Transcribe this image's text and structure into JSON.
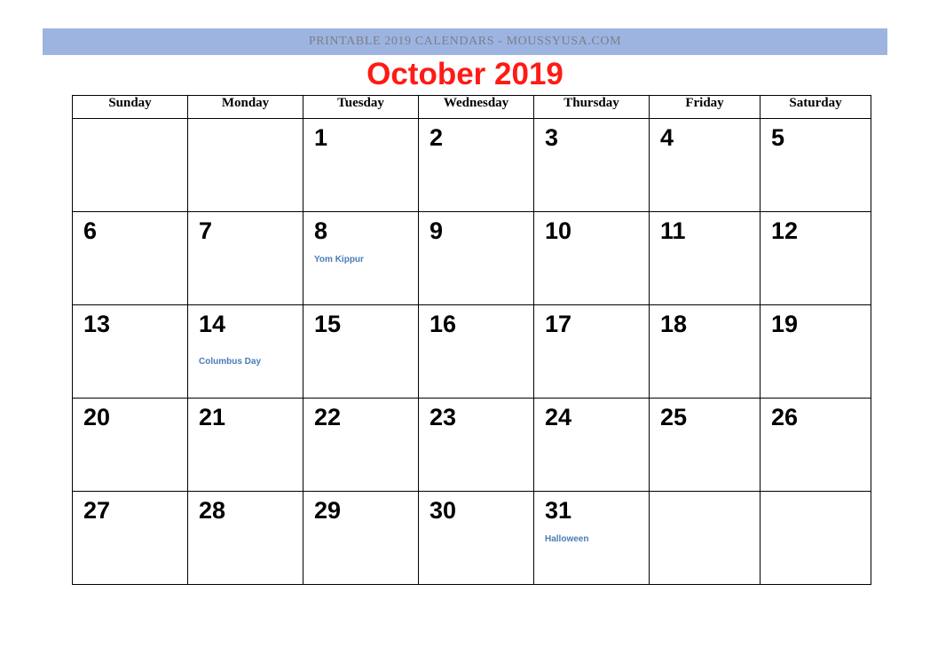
{
  "banner": {
    "text": "PRINTABLE 2019 CALENDARS - MOUSSYUSA.COM",
    "background_color": "#9db4e0",
    "text_color": "#7a7f88"
  },
  "title": {
    "text": "October 2019",
    "color": "#ff1a15"
  },
  "calendar": {
    "month": "October",
    "year": "2019",
    "weekday_headers": [
      "Sunday",
      "Monday",
      "Tuesday",
      "Wednesday",
      "Thursday",
      "Friday",
      "Saturday"
    ],
    "event_color": "#4a7cb5",
    "weeks": [
      [
        {
          "day": "",
          "event": ""
        },
        {
          "day": "",
          "event": ""
        },
        {
          "day": "1",
          "event": ""
        },
        {
          "day": "2",
          "event": ""
        },
        {
          "day": "3",
          "event": ""
        },
        {
          "day": "4",
          "event": ""
        },
        {
          "day": "5",
          "event": ""
        }
      ],
      [
        {
          "day": "6",
          "event": ""
        },
        {
          "day": "7",
          "event": ""
        },
        {
          "day": "8",
          "event": "Yom Kippur"
        },
        {
          "day": "9",
          "event": ""
        },
        {
          "day": "10",
          "event": ""
        },
        {
          "day": "11",
          "event": ""
        },
        {
          "day": "12",
          "event": ""
        }
      ],
      [
        {
          "day": "13",
          "event": ""
        },
        {
          "day": "14",
          "event": "Columbus Day",
          "event_low": true
        },
        {
          "day": "15",
          "event": ""
        },
        {
          "day": "16",
          "event": ""
        },
        {
          "day": "17",
          "event": ""
        },
        {
          "day": "18",
          "event": ""
        },
        {
          "day": "19",
          "event": ""
        }
      ],
      [
        {
          "day": "20",
          "event": ""
        },
        {
          "day": "21",
          "event": ""
        },
        {
          "day": "22",
          "event": ""
        },
        {
          "day": "23",
          "event": ""
        },
        {
          "day": "24",
          "event": ""
        },
        {
          "day": "25",
          "event": ""
        },
        {
          "day": "26",
          "event": ""
        }
      ],
      [
        {
          "day": "27",
          "event": ""
        },
        {
          "day": "28",
          "event": ""
        },
        {
          "day": "29",
          "event": ""
        },
        {
          "day": "30",
          "event": ""
        },
        {
          "day": "31",
          "event": "Halloween"
        },
        {
          "day": "",
          "event": ""
        },
        {
          "day": "",
          "event": ""
        }
      ]
    ]
  }
}
